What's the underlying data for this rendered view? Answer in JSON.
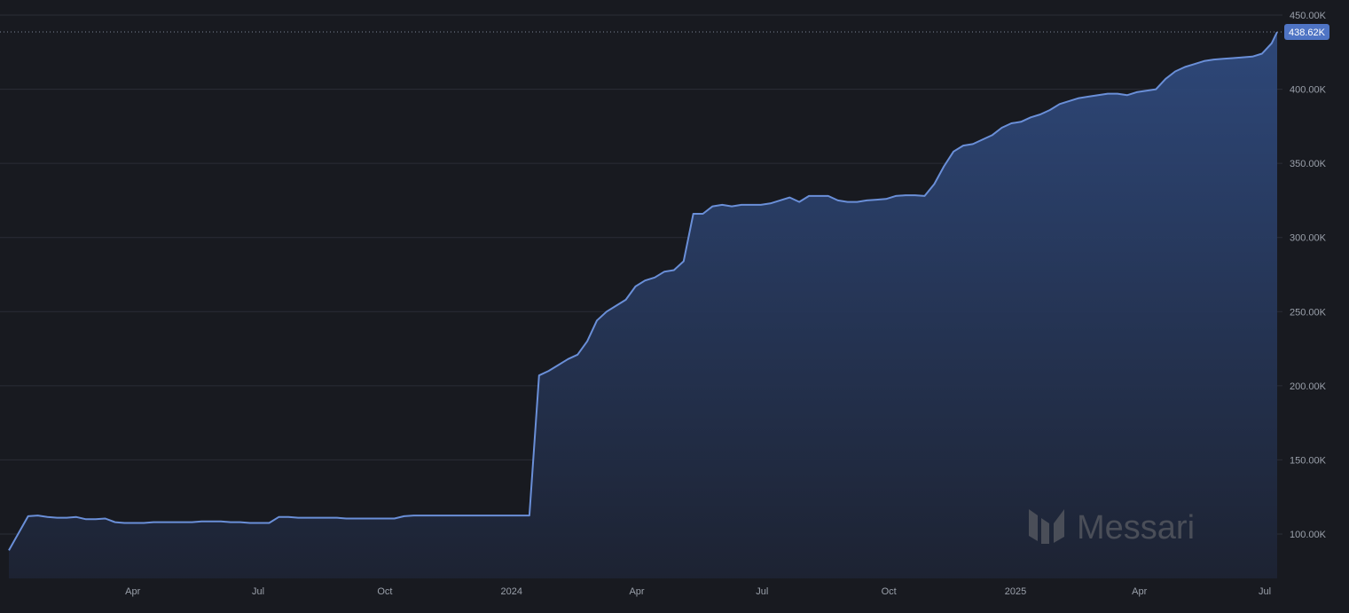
{
  "chart_data": {
    "type": "area",
    "title": "",
    "xlabel": "",
    "ylabel": "",
    "ylim": [
      75000,
      450000
    ],
    "y_ticks": [
      {
        "value": 100000,
        "label": "100.00K"
      },
      {
        "value": 150000,
        "label": "150.00K"
      },
      {
        "value": 200000,
        "label": "200.00K"
      },
      {
        "value": 250000,
        "label": "250.00K"
      },
      {
        "value": 300000,
        "label": "300.00K"
      },
      {
        "value": 350000,
        "label": "350.00K"
      },
      {
        "value": 400000,
        "label": "400.00K"
      },
      {
        "value": 450000,
        "label": "450.00K"
      }
    ],
    "x_ticks": [
      {
        "date": "2023-04-01",
        "label": "Apr"
      },
      {
        "date": "2023-07-01",
        "label": "Jul"
      },
      {
        "date": "2023-10-01",
        "label": "Oct"
      },
      {
        "date": "2024-01-01",
        "label": "2024"
      },
      {
        "date": "2024-04-01",
        "label": "Apr"
      },
      {
        "date": "2024-07-01",
        "label": "Jul"
      },
      {
        "date": "2024-10-01",
        "label": "Oct"
      },
      {
        "date": "2025-01-01",
        "label": "2025"
      },
      {
        "date": "2025-04-01",
        "label": "Apr"
      },
      {
        "date": "2025-07-01",
        "label": "Jul"
      }
    ],
    "xlim": [
      "2023-01-01",
      "2025-07-10"
    ],
    "grid": true,
    "last_value_label": "438.62K",
    "line_color": "#6a8fd8",
    "series": [
      {
        "x": [
          "2023-01-01",
          "2023-01-15",
          "2023-01-22",
          "2023-01-29",
          "2023-02-05",
          "2023-02-12",
          "2023-02-19",
          "2023-02-26",
          "2023-03-05",
          "2023-03-12",
          "2023-03-19",
          "2023-03-26",
          "2023-04-02",
          "2023-04-09",
          "2023-04-16",
          "2023-04-23",
          "2023-04-30",
          "2023-05-07",
          "2023-05-14",
          "2023-05-21",
          "2023-05-28",
          "2023-06-04",
          "2023-06-11",
          "2023-06-18",
          "2023-06-25",
          "2023-07-02",
          "2023-07-09",
          "2023-07-16",
          "2023-07-23",
          "2023-07-30",
          "2023-08-06",
          "2023-08-13",
          "2023-08-20",
          "2023-08-27",
          "2023-09-03",
          "2023-09-10",
          "2023-09-17",
          "2023-09-24",
          "2023-10-01",
          "2023-10-08",
          "2023-10-15",
          "2023-10-22",
          "2023-10-29",
          "2023-11-05",
          "2023-11-12",
          "2023-11-19",
          "2023-11-26",
          "2023-12-03",
          "2023-12-10",
          "2023-12-17",
          "2023-12-24",
          "2023-12-31",
          "2024-01-07",
          "2024-01-14",
          "2024-01-21",
          "2024-01-28",
          "2024-02-04",
          "2024-02-11",
          "2024-02-18",
          "2024-02-25",
          "2024-03-03",
          "2024-03-10",
          "2024-03-17",
          "2024-03-24",
          "2024-03-31",
          "2024-04-07",
          "2024-04-14",
          "2024-04-21",
          "2024-04-28",
          "2024-05-05",
          "2024-05-12",
          "2024-05-19",
          "2024-05-26",
          "2024-06-02",
          "2024-06-09",
          "2024-06-16",
          "2024-06-23",
          "2024-06-30",
          "2024-07-07",
          "2024-07-14",
          "2024-07-21",
          "2024-07-28",
          "2024-08-04",
          "2024-08-11",
          "2024-08-18",
          "2024-08-25",
          "2024-09-01",
          "2024-09-08",
          "2024-09-15",
          "2024-09-22",
          "2024-09-29",
          "2024-10-06",
          "2024-10-13",
          "2024-10-20",
          "2024-10-27",
          "2024-11-03",
          "2024-11-10",
          "2024-11-17",
          "2024-11-24",
          "2024-12-01",
          "2024-12-08",
          "2024-12-15",
          "2024-12-22",
          "2024-12-29",
          "2025-01-05",
          "2025-01-12",
          "2025-01-19",
          "2025-01-26",
          "2025-02-02",
          "2025-02-09",
          "2025-02-16",
          "2025-02-23",
          "2025-03-02",
          "2025-03-09",
          "2025-03-16",
          "2025-03-23",
          "2025-03-30",
          "2025-04-06",
          "2025-04-13",
          "2025-04-20",
          "2025-04-27",
          "2025-05-04",
          "2025-05-11",
          "2025-05-18",
          "2025-05-25",
          "2025-06-01",
          "2025-06-08",
          "2025-06-15",
          "2025-06-22",
          "2025-06-29",
          "2025-07-06",
          "2025-07-10"
        ],
        "values": [
          89000,
          112000,
          112500,
          111500,
          111000,
          111000,
          111500,
          110000,
          110000,
          110500,
          108000,
          107500,
          107500,
          107500,
          108000,
          108000,
          108000,
          108000,
          108000,
          108500,
          108500,
          108500,
          108000,
          108000,
          107500,
          107500,
          107500,
          111500,
          111500,
          111000,
          111000,
          111000,
          111000,
          111000,
          110500,
          110500,
          110500,
          110500,
          110500,
          110500,
          112000,
          112500,
          112500,
          112500,
          112500,
          112500,
          112500,
          112500,
          112500,
          112500,
          112500,
          112500,
          112500,
          112500,
          207000,
          210000,
          214000,
          218000,
          221000,
          230000,
          244000,
          250000,
          254000,
          258000,
          267000,
          271000,
          273000,
          277000,
          278000,
          284000,
          316000,
          316000,
          321000,
          322000,
          321000,
          322000,
          322000,
          322000,
          323000,
          325000,
          327000,
          324000,
          328000,
          328000,
          328000,
          325000,
          324000,
          324000,
          325000,
          325500,
          326000,
          328000,
          328500,
          328500,
          328000,
          336000,
          348000,
          358000,
          362000,
          363000,
          366000,
          369000,
          374000,
          377000,
          378000,
          381000,
          383000,
          386000,
          390000,
          392000,
          394000,
          395000,
          396000,
          397000,
          397000,
          396000,
          398000,
          399000,
          400000,
          407000,
          412000,
          415000,
          417000,
          419000,
          420000,
          420500,
          421000,
          421500,
          422000,
          424000,
          431000,
          438620
        ]
      }
    ]
  },
  "watermark": {
    "text": "Messari",
    "icon": "messari-logo-icon"
  }
}
